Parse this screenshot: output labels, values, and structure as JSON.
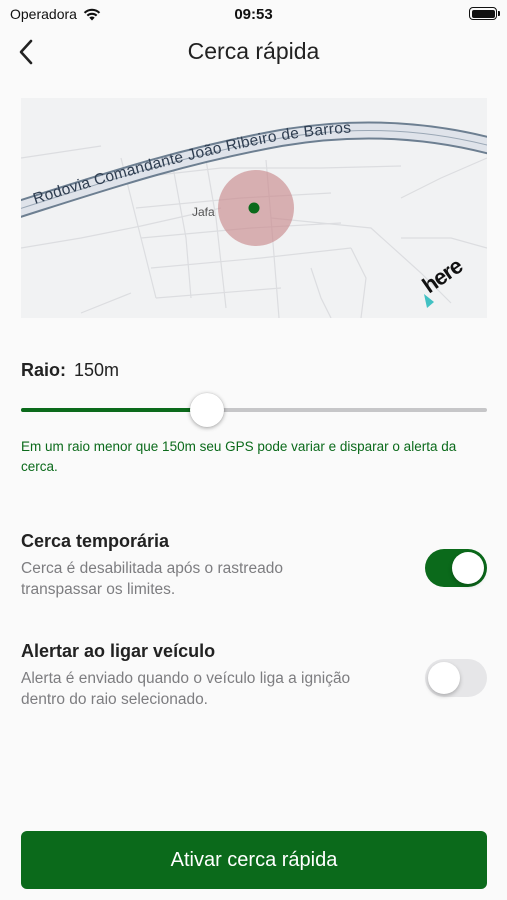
{
  "status_bar": {
    "carrier": "Operadora",
    "time": "09:53",
    "wifi_icon": "wifi-icon",
    "battery_icon": "battery-icon"
  },
  "nav": {
    "back_icon": "chevron-left-icon",
    "title": "Cerca rápida"
  },
  "map": {
    "road_name": "Rodovia Comandante João Ribeiro de Barros",
    "town_label": "Jafa",
    "provider_logo": "here",
    "geofence_color": "#c98a8e",
    "marker_color": "#0b6a1b"
  },
  "radius": {
    "label": "Raio:",
    "value": "150m",
    "slider_fraction": 0.4
  },
  "hint": "Em um raio menor que 150m seu GPS pode variar e disparar o alerta da cerca.",
  "options": [
    {
      "title": "Cerca temporária",
      "description": "Cerca é desabilitada após o rastreado transpassar os limites.",
      "enabled": true
    },
    {
      "title": "Alertar ao ligar veículo",
      "description": "Alerta é enviado quando o veículo liga a ignição dentro do raio selecionado.",
      "enabled": false
    }
  ],
  "cta_label": "Ativar cerca rápida",
  "colors": {
    "accent": "#0b6a1b",
    "toggle_off": "#e6e6e8",
    "secondary_text": "#7d7d80"
  }
}
